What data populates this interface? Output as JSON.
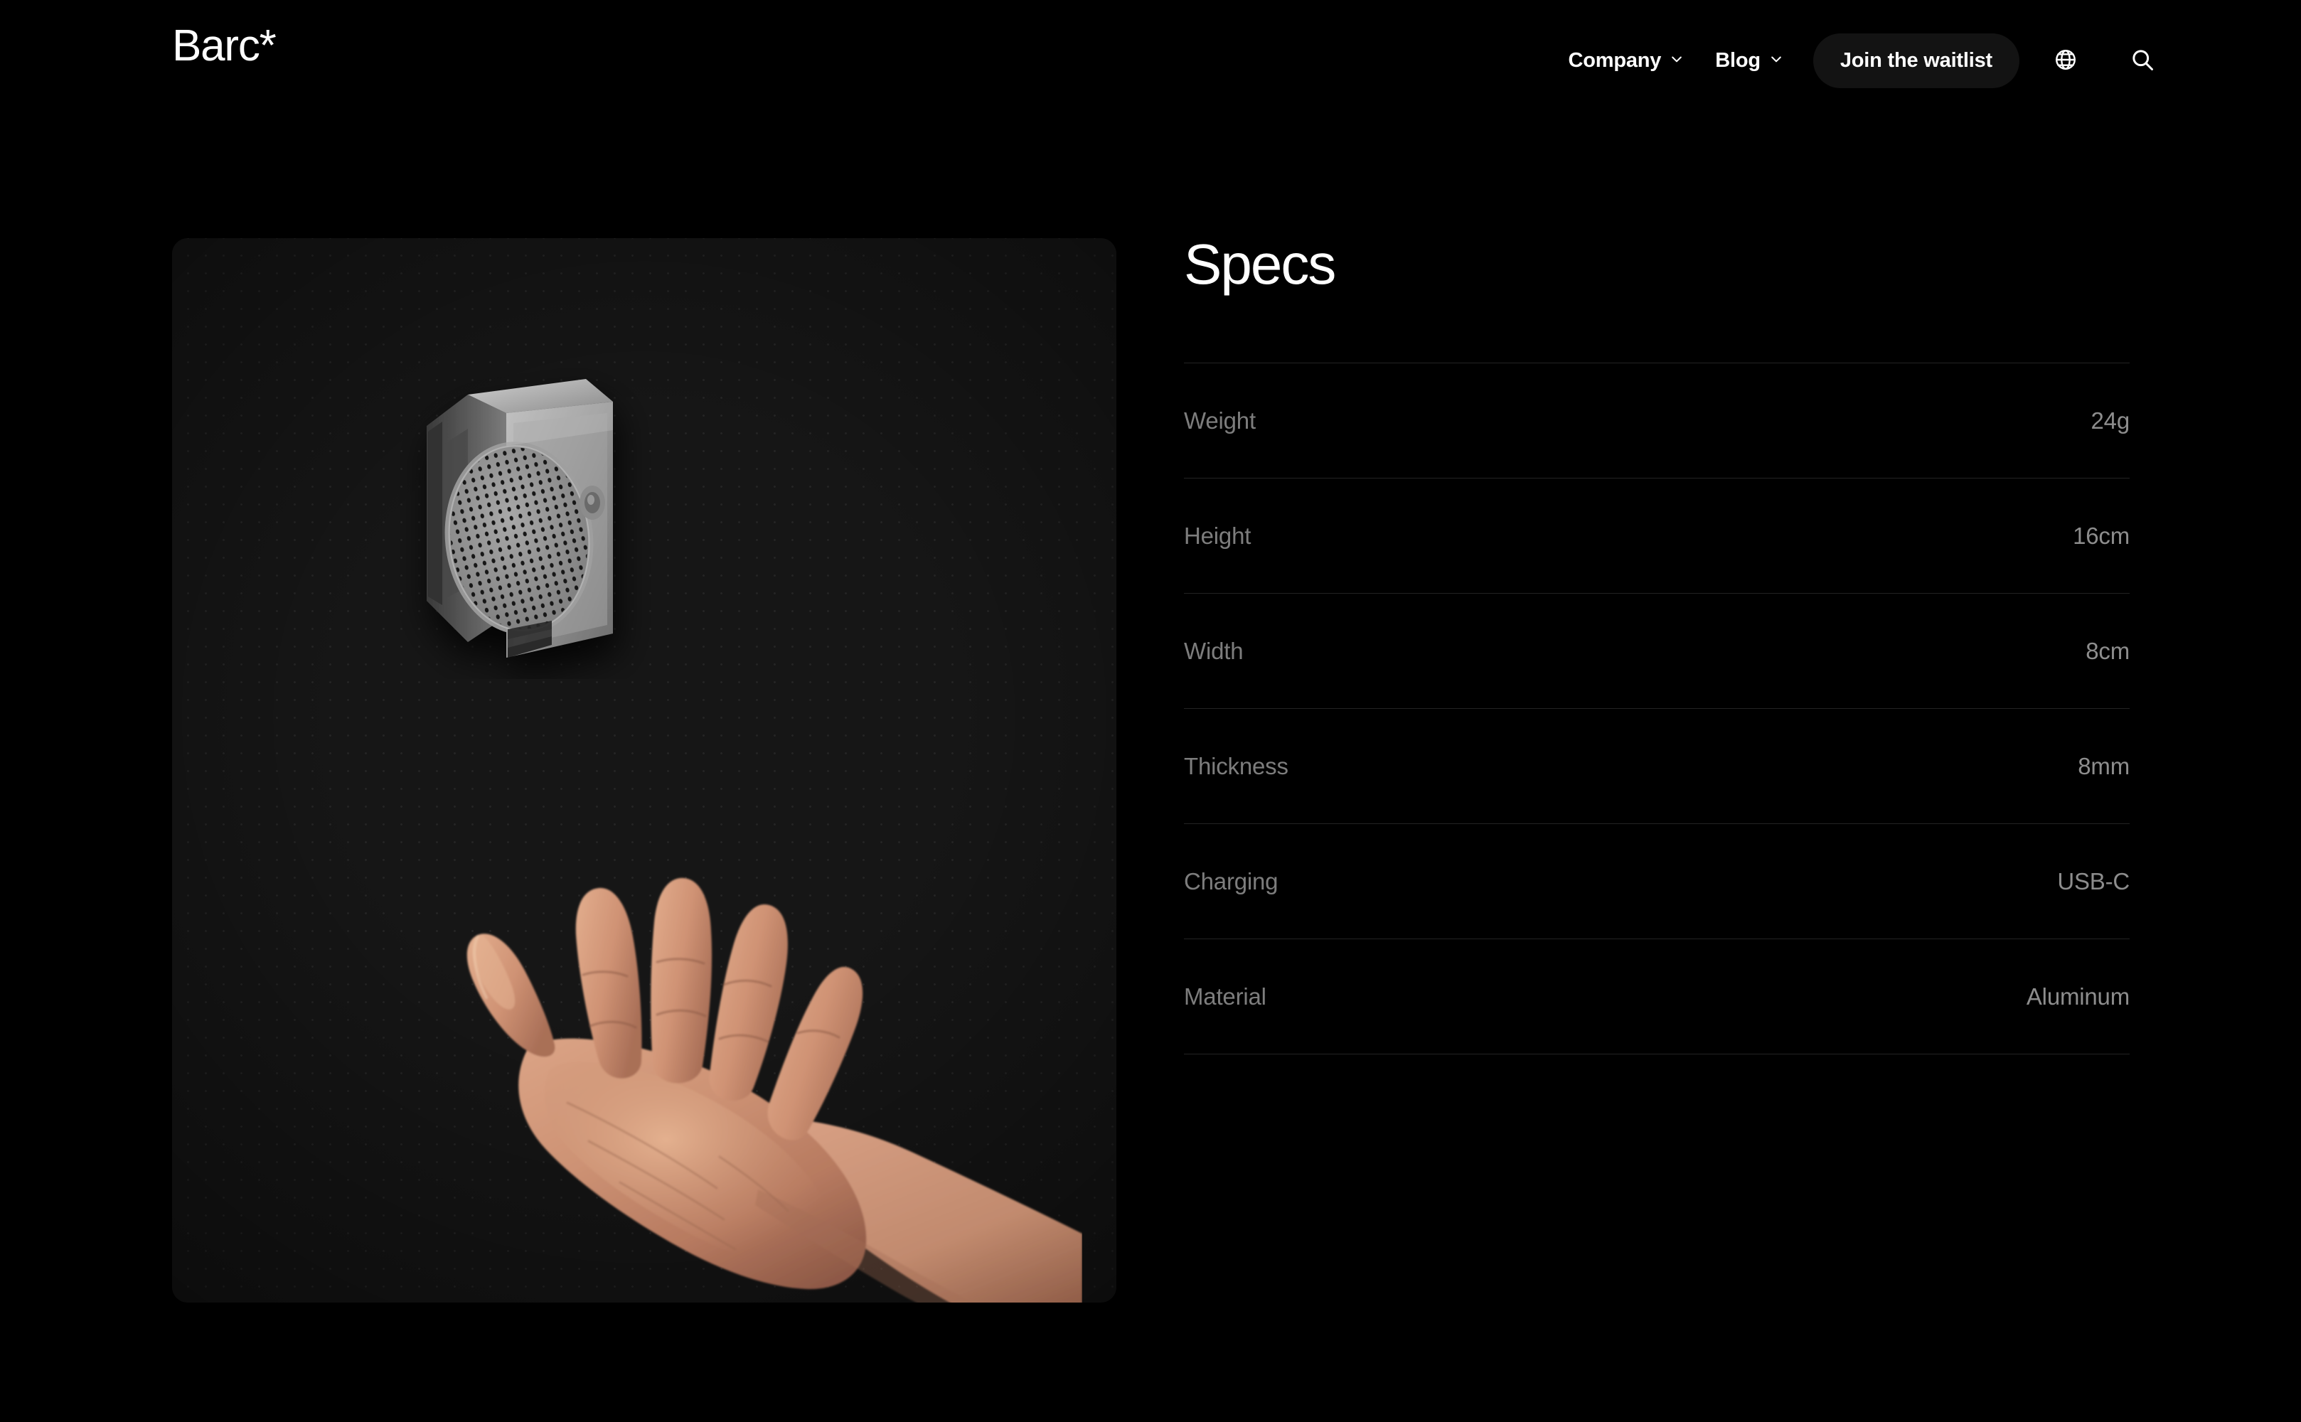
{
  "brand": {
    "name": "Barc*"
  },
  "nav": {
    "items": [
      {
        "label": "Company",
        "has_chevron": true,
        "icon": "chevron-down-icon"
      },
      {
        "label": "Blog",
        "has_chevron": true,
        "icon": "chevron-down-icon"
      }
    ],
    "cta": {
      "label": "Join the waitlist"
    },
    "icons": [
      {
        "name": "globe-icon",
        "label": "Language"
      },
      {
        "name": "search-icon",
        "label": "Search"
      }
    ]
  },
  "product_card": {
    "device": {
      "name": "barc-speaker-device",
      "material_look": "aluminum"
    },
    "hand": {
      "name": "open-hand-photo"
    },
    "background_pattern": "dot-grid"
  },
  "specs": {
    "title": "Specs",
    "rows": [
      {
        "label": "Weight",
        "value": "24g"
      },
      {
        "label": "Height",
        "value": "16cm"
      },
      {
        "label": "Width",
        "value": "8cm"
      },
      {
        "label": "Thickness",
        "value": "8mm"
      },
      {
        "label": "Charging",
        "value": "USB-C"
      },
      {
        "label": "Material",
        "value": "Aluminum"
      }
    ]
  },
  "colors": {
    "page_background": "#000000",
    "card_background": "#161616",
    "dot_color": "#252525",
    "text_primary": "#ffffff",
    "text_muted": "#8a8a8a",
    "divider": "#232323",
    "cta_background": "#131313"
  }
}
